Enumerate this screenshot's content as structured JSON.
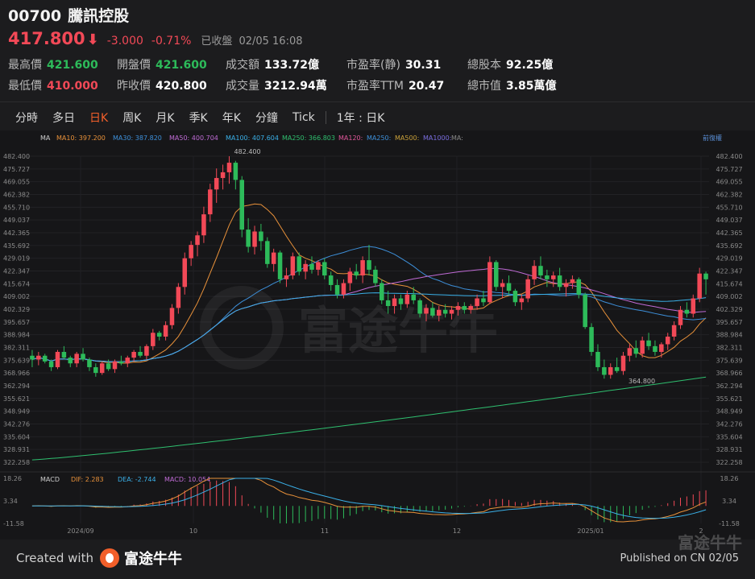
{
  "header": {
    "code": "00700",
    "name": "騰訊控股",
    "price": "417.800",
    "change": "-3.000",
    "change_pct": "-0.71%",
    "status": "已收盤",
    "time": "02/05 16:08"
  },
  "stats": [
    {
      "label": "最高價",
      "value": "421.600",
      "color": "g"
    },
    {
      "label": "開盤價",
      "value": "421.600",
      "color": "g"
    },
    {
      "label": "成交額",
      "value": "133.72億",
      "color": ""
    },
    {
      "label": "市盈率(静)",
      "value": "30.31",
      "color": ""
    },
    {
      "label": "總股本",
      "value": "92.25億",
      "color": ""
    },
    {
      "label": "最低價",
      "value": "410.000",
      "color": "r"
    },
    {
      "label": "昨收價",
      "value": "420.800",
      "color": ""
    },
    {
      "label": "成交量",
      "value": "3212.94萬",
      "color": ""
    },
    {
      "label": "市盈率TTM",
      "value": "20.47",
      "color": ""
    },
    {
      "label": "總市值",
      "value": "3.85萬億",
      "color": ""
    }
  ],
  "tabs": [
    "分時",
    "多日",
    "日K",
    "周K",
    "月K",
    "季K",
    "年K",
    "分鐘",
    "Tick"
  ],
  "active_tab": "日K",
  "range_tab": "1年 : 日K",
  "ma_legend": {
    "label": "MA",
    "items": [
      {
        "name": "MA10:",
        "value": "397.200",
        "color": "#e8913a"
      },
      {
        "name": "MA30:",
        "value": "387.820",
        "color": "#3d8fd9"
      },
      {
        "name": "MA50:",
        "value": "400.704",
        "color": "#c06bd6"
      },
      {
        "name": "MA100:",
        "value": "407.604",
        "color": "#3ab0e8"
      },
      {
        "name": "MA250:",
        "value": "366.803",
        "color": "#2fbf6f"
      },
      {
        "name": "MA120:",
        "value": "",
        "color": "#e0569a"
      },
      {
        "name": "MA250:",
        "value": "",
        "color": "#3d8fd9"
      },
      {
        "name": "MA500:",
        "value": "",
        "color": "#c9a13a"
      },
      {
        "name": "MA1000:",
        "value": "",
        "color": "#7a6ee0"
      },
      {
        "name": "MA:",
        "value": "",
        "color": "#888888"
      }
    ],
    "adjust": "前復權"
  },
  "macd_legend": {
    "label": "MACD",
    "items": [
      {
        "name": "DIF:",
        "value": "2.283",
        "color": "#e8913a"
      },
      {
        "name": "DEA:",
        "value": "-2.744",
        "color": "#3ab0e8"
      },
      {
        "name": "MACD:",
        "value": "10.054",
        "color": "#c06bd6"
      }
    ]
  },
  "price_axis": [
    "482.400",
    "475.727",
    "469.055",
    "462.382",
    "455.710",
    "449.037",
    "442.365",
    "435.692",
    "429.019",
    "422.347",
    "415.674",
    "409.002",
    "402.329",
    "395.657",
    "388.984",
    "382.311",
    "375.639",
    "368.966",
    "362.294",
    "355.621",
    "348.949",
    "342.276",
    "335.604",
    "328.931",
    "322.258"
  ],
  "macd_axis": [
    "18.26",
    "3.34",
    "-11.58"
  ],
  "date_axis": [
    "2024/09",
    "10",
    "11",
    "12",
    "2025/01",
    "2"
  ],
  "annotations": {
    "high": "482.400",
    "low": "364.800"
  },
  "watermark": "富途牛牛",
  "footer": {
    "created_with": "Created with",
    "brand": "富途牛牛",
    "published": "Published on CN 02/05",
    "corner_mark": "富途牛牛"
  },
  "colors": {
    "up": "#f24957",
    "down": "#2dbb5a",
    "accent": "#f25f2a",
    "bg": "#161618"
  },
  "chart_data": {
    "type": "candlestick",
    "ylim": [
      322.258,
      482.4
    ],
    "candles": [
      {
        "o": 378,
        "h": 381,
        "l": 372,
        "c": 376
      },
      {
        "o": 376,
        "h": 380,
        "l": 373,
        "c": 378
      },
      {
        "o": 378,
        "h": 379,
        "l": 374,
        "c": 375
      },
      {
        "o": 375,
        "h": 376,
        "l": 370,
        "c": 372
      },
      {
        "o": 372,
        "h": 381,
        "l": 371,
        "c": 380
      },
      {
        "o": 380,
        "h": 383,
        "l": 376,
        "c": 377
      },
      {
        "o": 377,
        "h": 378,
        "l": 372,
        "c": 374
      },
      {
        "o": 374,
        "h": 380,
        "l": 372,
        "c": 379
      },
      {
        "o": 379,
        "h": 382,
        "l": 375,
        "c": 376
      },
      {
        "o": 376,
        "h": 377,
        "l": 370,
        "c": 372
      },
      {
        "o": 372,
        "h": 374,
        "l": 367,
        "c": 369
      },
      {
        "o": 369,
        "h": 375,
        "l": 368,
        "c": 374
      },
      {
        "o": 374,
        "h": 376,
        "l": 370,
        "c": 371
      },
      {
        "o": 371,
        "h": 376,
        "l": 369,
        "c": 375
      },
      {
        "o": 375,
        "h": 378,
        "l": 373,
        "c": 374
      },
      {
        "o": 374,
        "h": 378,
        "l": 372,
        "c": 377
      },
      {
        "o": 377,
        "h": 381,
        "l": 375,
        "c": 380
      },
      {
        "o": 380,
        "h": 383,
        "l": 377,
        "c": 378
      },
      {
        "o": 378,
        "h": 384,
        "l": 376,
        "c": 383
      },
      {
        "o": 383,
        "h": 392,
        "l": 381,
        "c": 390
      },
      {
        "o": 390,
        "h": 391,
        "l": 386,
        "c": 388
      },
      {
        "o": 388,
        "h": 396,
        "l": 386,
        "c": 394
      },
      {
        "o": 394,
        "h": 405,
        "l": 392,
        "c": 403
      },
      {
        "o": 403,
        "h": 416,
        "l": 400,
        "c": 414
      },
      {
        "o": 414,
        "h": 432,
        "l": 410,
        "c": 429
      },
      {
        "o": 429,
        "h": 438,
        "l": 425,
        "c": 436
      },
      {
        "o": 436,
        "h": 443,
        "l": 430,
        "c": 441
      },
      {
        "o": 441,
        "h": 456,
        "l": 437,
        "c": 452
      },
      {
        "o": 452,
        "h": 468,
        "l": 448,
        "c": 465
      },
      {
        "o": 465,
        "h": 476,
        "l": 458,
        "c": 471
      },
      {
        "o": 471,
        "h": 478,
        "l": 465,
        "c": 474
      },
      {
        "o": 474,
        "h": 482.4,
        "l": 468,
        "c": 479
      },
      {
        "o": 479,
        "h": 480,
        "l": 465,
        "c": 470
      },
      {
        "o": 470,
        "h": 472,
        "l": 440,
        "c": 444
      },
      {
        "o": 444,
        "h": 450,
        "l": 432,
        "c": 435
      },
      {
        "o": 435,
        "h": 446,
        "l": 431,
        "c": 443
      },
      {
        "o": 443,
        "h": 447,
        "l": 433,
        "c": 438
      },
      {
        "o": 438,
        "h": 440,
        "l": 424,
        "c": 426
      },
      {
        "o": 426,
        "h": 434,
        "l": 422,
        "c": 432
      },
      {
        "o": 432,
        "h": 433,
        "l": 416,
        "c": 418
      },
      {
        "o": 418,
        "h": 424,
        "l": 414,
        "c": 420
      },
      {
        "o": 420,
        "h": 432,
        "l": 418,
        "c": 430
      },
      {
        "o": 430,
        "h": 432,
        "l": 420,
        "c": 422
      },
      {
        "o": 422,
        "h": 428,
        "l": 418,
        "c": 426
      },
      {
        "o": 426,
        "h": 430,
        "l": 421,
        "c": 423
      },
      {
        "o": 423,
        "h": 428,
        "l": 420,
        "c": 427
      },
      {
        "o": 427,
        "h": 429,
        "l": 418,
        "c": 420
      },
      {
        "o": 420,
        "h": 422,
        "l": 412,
        "c": 415
      },
      {
        "o": 415,
        "h": 418,
        "l": 408,
        "c": 410
      },
      {
        "o": 410,
        "h": 418,
        "l": 408,
        "c": 416
      },
      {
        "o": 416,
        "h": 424,
        "l": 412,
        "c": 422
      },
      {
        "o": 422,
        "h": 426,
        "l": 418,
        "c": 420
      },
      {
        "o": 420,
        "h": 430,
        "l": 416,
        "c": 428
      },
      {
        "o": 428,
        "h": 436,
        "l": 420,
        "c": 423
      },
      {
        "o": 423,
        "h": 425,
        "l": 414,
        "c": 416
      },
      {
        "o": 416,
        "h": 418,
        "l": 405,
        "c": 407
      },
      {
        "o": 407,
        "h": 412,
        "l": 400,
        "c": 404
      },
      {
        "o": 404,
        "h": 410,
        "l": 400,
        "c": 408
      },
      {
        "o": 408,
        "h": 410,
        "l": 402,
        "c": 405
      },
      {
        "o": 405,
        "h": 412,
        "l": 403,
        "c": 410
      },
      {
        "o": 410,
        "h": 414,
        "l": 405,
        "c": 407
      },
      {
        "o": 407,
        "h": 408,
        "l": 398,
        "c": 400
      },
      {
        "o": 400,
        "h": 405,
        "l": 396,
        "c": 403
      },
      {
        "o": 403,
        "h": 406,
        "l": 398,
        "c": 399
      },
      {
        "o": 399,
        "h": 404,
        "l": 396,
        "c": 402
      },
      {
        "o": 402,
        "h": 405,
        "l": 398,
        "c": 400
      },
      {
        "o": 400,
        "h": 404,
        "l": 397,
        "c": 402
      },
      {
        "o": 402,
        "h": 406,
        "l": 399,
        "c": 404
      },
      {
        "o": 404,
        "h": 406,
        "l": 400,
        "c": 402
      },
      {
        "o": 402,
        "h": 405,
        "l": 400,
        "c": 404
      },
      {
        "o": 404,
        "h": 410,
        "l": 402,
        "c": 408
      },
      {
        "o": 408,
        "h": 412,
        "l": 404,
        "c": 406
      },
      {
        "o": 406,
        "h": 430,
        "l": 405,
        "c": 427
      },
      {
        "o": 427,
        "h": 428,
        "l": 412,
        "c": 414
      },
      {
        "o": 414,
        "h": 418,
        "l": 408,
        "c": 416
      },
      {
        "o": 416,
        "h": 420,
        "l": 410,
        "c": 412
      },
      {
        "o": 412,
        "h": 413,
        "l": 404,
        "c": 406
      },
      {
        "o": 406,
        "h": 410,
        "l": 402,
        "c": 408
      },
      {
        "o": 408,
        "h": 420,
        "l": 406,
        "c": 418
      },
      {
        "o": 418,
        "h": 428,
        "l": 415,
        "c": 425
      },
      {
        "o": 425,
        "h": 430,
        "l": 418,
        "c": 420
      },
      {
        "o": 420,
        "h": 423,
        "l": 414,
        "c": 418
      },
      {
        "o": 418,
        "h": 422,
        "l": 414,
        "c": 420
      },
      {
        "o": 420,
        "h": 424,
        "l": 412,
        "c": 414
      },
      {
        "o": 414,
        "h": 418,
        "l": 409,
        "c": 416
      },
      {
        "o": 416,
        "h": 420,
        "l": 413,
        "c": 418
      },
      {
        "o": 418,
        "h": 419,
        "l": 408,
        "c": 410
      },
      {
        "o": 410,
        "h": 411,
        "l": 392,
        "c": 393
      },
      {
        "o": 393,
        "h": 395,
        "l": 378,
        "c": 380
      },
      {
        "o": 380,
        "h": 384,
        "l": 370,
        "c": 372
      },
      {
        "o": 372,
        "h": 376,
        "l": 366,
        "c": 368
      },
      {
        "o": 368,
        "h": 374,
        "l": 366,
        "c": 372
      },
      {
        "o": 372,
        "h": 377,
        "l": 369,
        "c": 370
      },
      {
        "o": 370,
        "h": 380,
        "l": 368,
        "c": 378
      },
      {
        "o": 378,
        "h": 384,
        "l": 375,
        "c": 382
      },
      {
        "o": 382,
        "h": 386,
        "l": 377,
        "c": 379
      },
      {
        "o": 379,
        "h": 388,
        "l": 377,
        "c": 386
      },
      {
        "o": 386,
        "h": 390,
        "l": 381,
        "c": 383
      },
      {
        "o": 383,
        "h": 386,
        "l": 378,
        "c": 380
      },
      {
        "o": 380,
        "h": 385,
        "l": 377,
        "c": 384
      },
      {
        "o": 384,
        "h": 390,
        "l": 381,
        "c": 388
      },
      {
        "o": 388,
        "h": 396,
        "l": 386,
        "c": 394
      },
      {
        "o": 394,
        "h": 404,
        "l": 392,
        "c": 402
      },
      {
        "o": 402,
        "h": 406,
        "l": 398,
        "c": 400
      },
      {
        "o": 400,
        "h": 410,
        "l": 398,
        "c": 408
      },
      {
        "o": 408,
        "h": 424,
        "l": 406,
        "c": 421
      },
      {
        "o": 421,
        "h": 422,
        "l": 410,
        "c": 418
      }
    ],
    "macd_range": [
      -11.58,
      18.26
    ]
  }
}
